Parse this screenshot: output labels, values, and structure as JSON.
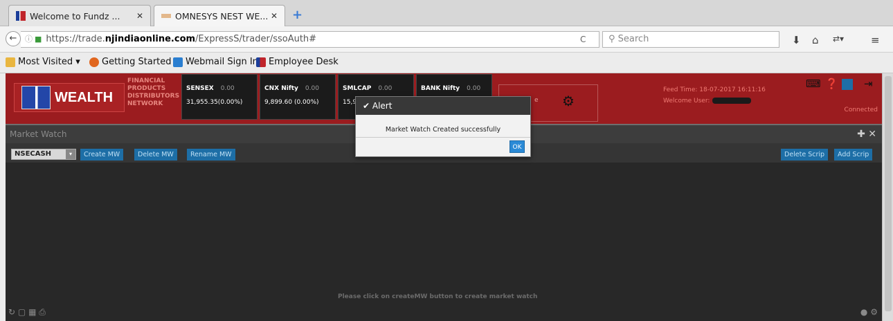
{
  "browser": {
    "tabs": [
      {
        "title": "Welcome to Fundz ..."
      },
      {
        "title": "OMNESYS NEST WE..."
      }
    ],
    "url_prefix": "https://trade.",
    "url_domain": "njindiaonline.com",
    "url_path": "/ExpressS/trader/ssoAuth#",
    "search_placeholder": "Search",
    "bookmarks": [
      {
        "label": "Most Visited ▾"
      },
      {
        "label": "Getting Started"
      },
      {
        "label": "Webmail Sign In"
      },
      {
        "label": "Employee Desk"
      }
    ]
  },
  "header": {
    "brand": "WEALTH",
    "tagline": [
      "FINANCIAL",
      "PRODUCTS",
      "DISTRIBUTORS",
      "NETWORK"
    ],
    "indices": [
      {
        "name": "SENSEX",
        "change": "0.00",
        "value": "31,955.35(0.00%)"
      },
      {
        "name": "CNX Nifty",
        "change": "0.00",
        "value": "9,899.60 (0.00%)"
      },
      {
        "name": "SMLCAP",
        "change": "0.00",
        "value": "15,9"
      },
      {
        "name": "BANK Nifty",
        "change": "0.00",
        "value": ""
      }
    ],
    "mini_text": "e",
    "feed_time": "Feed Time: 18-07-2017 16:11:16",
    "welcome": "Welcome User:",
    "status": "Connected"
  },
  "market_watch": {
    "title": "Market Watch",
    "exchange": "NSECASH",
    "buttons": {
      "create": "Create MW",
      "delete": "Delete MW",
      "rename": "Rename MW",
      "delete_scrip": "Delete Scrip",
      "add_scrip": "Add Scrip"
    },
    "hint": "Please click on createMW button to create market watch"
  },
  "alert": {
    "title": "Alert",
    "message": "Market Watch Created successfully",
    "ok": "OK"
  },
  "colors": {
    "header_red": "#9b1c1f",
    "panel_dark": "#282828",
    "button_blue": "#1d6ea6"
  }
}
